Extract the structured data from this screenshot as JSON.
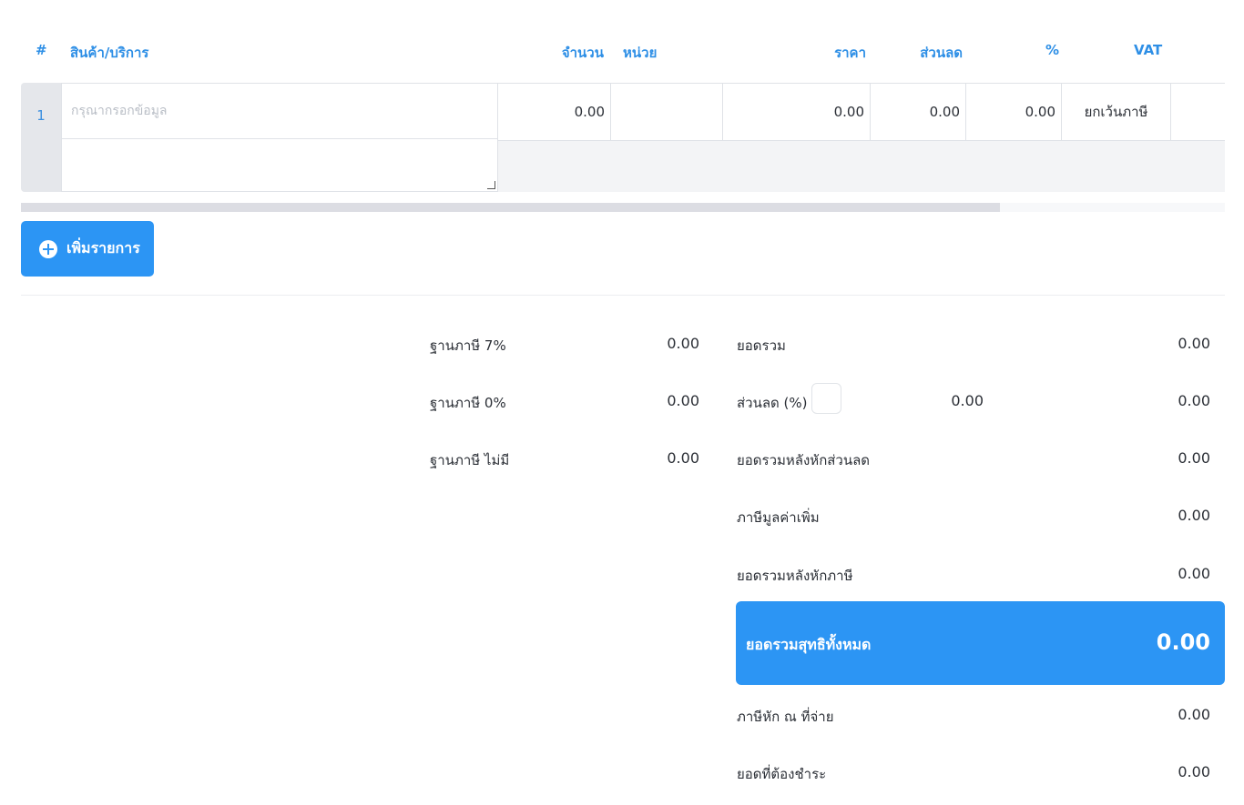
{
  "table": {
    "headers": {
      "index": "#",
      "product": "สินค้า/บริการ",
      "quantity": "จำนวน",
      "unit": "หน่วย",
      "price": "ราคา",
      "discount": "ส่วนลด",
      "percent": "%",
      "vat": "VAT"
    },
    "rows": [
      {
        "index": "1",
        "product_placeholder": "กรุณากรอกข้อมูล",
        "quantity": "0.00",
        "unit": "",
        "price": "0.00",
        "discount": "0.00",
        "percent": "0.00",
        "vat": "ยกเว้นภาษี"
      }
    ]
  },
  "add_item_label": "เพิ่มรายการ",
  "tax_base": [
    {
      "label": "ฐานภาษี 7%",
      "value": "0.00"
    },
    {
      "label": "ฐานภาษี 0%",
      "value": "0.00"
    },
    {
      "label": "ฐานภาษี ไม่มี",
      "value": "0.00"
    }
  ],
  "summary": {
    "subtotal": {
      "label": "ยอดรวม",
      "value": "0.00"
    },
    "discount": {
      "label": "ส่วนลด (%)",
      "input_value": "",
      "amount": "0.00",
      "value": "0.00"
    },
    "after_discount": {
      "label": "ยอดรวมหลังหักส่วนลด",
      "value": "0.00"
    },
    "vat": {
      "label": "ภาษีมูลค่าเพิ่ม",
      "value": "0.00"
    },
    "after_vat": {
      "label": "ยอดรวมหลังหักภาษี",
      "value": "0.00"
    },
    "grand_total": {
      "label": "ยอดรวมสุทธิทั้งหมด",
      "value": "0.00"
    },
    "withholding": {
      "label": "ภาษีหัก ณ ที่จ่าย",
      "value": "0.00"
    },
    "amount_due": {
      "label": "ยอดที่ต้องชำระ",
      "value": "0.00"
    }
  },
  "colors": {
    "accent": "#2c95f4",
    "header_text": "#2e8fe6",
    "row_index_bg": "#e5e7eb"
  }
}
